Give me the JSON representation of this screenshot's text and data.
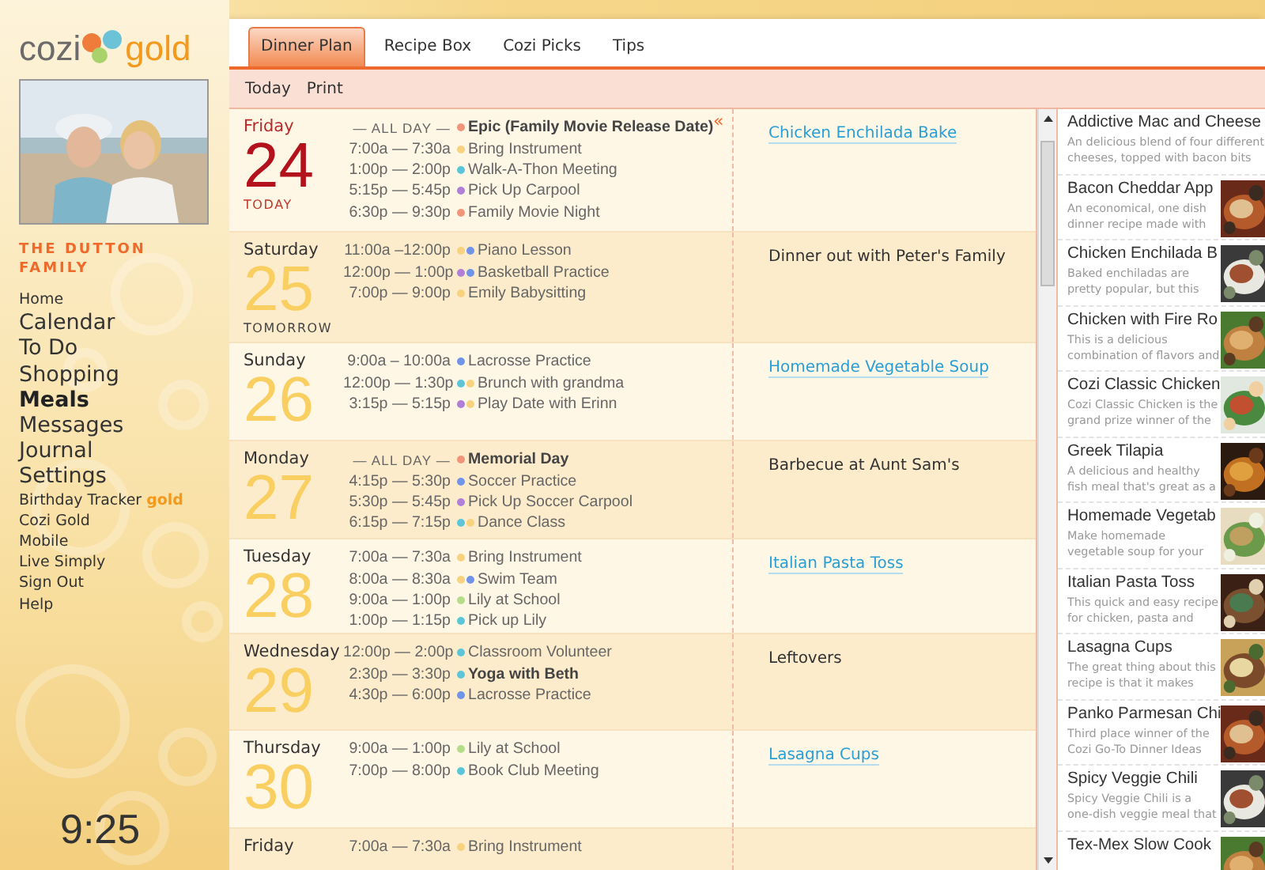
{
  "logo": {
    "name": "cozi",
    "edition": "gold"
  },
  "family": "THE DUTTON FAMILY",
  "nav": [
    {
      "label": "Home",
      "kind": "small",
      "selected": false
    },
    {
      "label": "Calendar",
      "kind": "large",
      "selected": false
    },
    {
      "label": "To Do",
      "kind": "large",
      "selected": false
    },
    {
      "label": "Shopping",
      "kind": "large",
      "selected": false
    },
    {
      "label": "Meals",
      "kind": "large",
      "selected": true
    },
    {
      "label": "Messages",
      "kind": "large",
      "selected": false
    },
    {
      "label": "Journal",
      "kind": "large",
      "selected": false
    },
    {
      "label": "Settings",
      "kind": "large",
      "selected": false
    },
    {
      "label": "Birthday Tracker",
      "kind": "small",
      "selected": false,
      "badge": "gold"
    },
    {
      "label": "Cozi Gold",
      "kind": "small",
      "selected": false
    },
    {
      "label": "Mobile",
      "kind": "small",
      "selected": false
    },
    {
      "label": "Live Simply",
      "kind": "small",
      "selected": false
    },
    {
      "label": "Sign Out",
      "kind": "small",
      "selected": false
    },
    {
      "label": "Help",
      "kind": "small",
      "selected": false
    }
  ],
  "clock": "9:25",
  "tabs": [
    {
      "label": "Dinner Plan",
      "selected": true
    },
    {
      "label": "Recipe Box",
      "selected": false
    },
    {
      "label": "Cozi Picks",
      "selected": false
    },
    {
      "label": "Tips",
      "selected": false
    }
  ],
  "toolbar": [
    "Today",
    "Print"
  ],
  "days": [
    {
      "weekday": "Friday",
      "date": "24",
      "note": "TODAY",
      "today": true,
      "shaded": false,
      "collapse": "«",
      "events": [
        {
          "time": "— ALL DAY —",
          "title": "Epic (Family Movie Release Date)",
          "dots": [
            {
              "color": "#f0957a"
            }
          ],
          "bold": true,
          "allday": true
        },
        {
          "time": "7:00a — 7:30a",
          "title": "Bring Instrument",
          "dots": [
            {
              "color": "#f8d27f"
            }
          ],
          "bold": false,
          "allday": false
        },
        {
          "time": "1:00p — 2:00p",
          "title": "Walk-A-Thon Meeting",
          "dots": [
            {
              "color": "#5cc6d8"
            }
          ],
          "bold": false,
          "allday": false
        },
        {
          "time": "5:15p — 5:45p",
          "title": "Pick Up Carpool",
          "dots": [
            {
              "color": "#b07fd8"
            }
          ],
          "bold": false,
          "allday": false
        },
        {
          "time": "6:30p — 9:30p",
          "title": "Family Movie Night",
          "dots": [
            {
              "color": "#f0957a"
            }
          ],
          "bold": false,
          "allday": false
        }
      ],
      "dinner": {
        "text": "Chicken Enchilada Bake",
        "kind": "link"
      }
    },
    {
      "weekday": "Saturday",
      "date": "25",
      "note": "TOMORROW",
      "today": false,
      "shaded": true,
      "events": [
        {
          "time": "11:00a –12:00p",
          "title": "Piano Lesson",
          "dots": [
            {
              "color": "#f8d27f"
            },
            {
              "color": "#7094e8"
            }
          ],
          "bold": false,
          "allday": false
        },
        {
          "time": "12:00p — 1:00p",
          "title": "Basketball Practice",
          "dots": [
            {
              "color": "#b07fd8"
            },
            {
              "color": "#7094e8"
            }
          ],
          "bold": false,
          "allday": false
        },
        {
          "time": "7:00p — 9:00p",
          "title": "Emily Babysitting",
          "dots": [
            {
              "color": "#f8d27f"
            }
          ],
          "bold": false,
          "allday": false
        }
      ],
      "dinner": {
        "text": "Dinner out with Peter's Family",
        "kind": "text"
      }
    },
    {
      "weekday": "Sunday",
      "date": "26",
      "today": false,
      "shaded": false,
      "events": [
        {
          "time": "9:00a – 10:00a",
          "title": "Lacrosse Practice",
          "dots": [
            {
              "color": "#7094e8"
            }
          ],
          "bold": false,
          "allday": false
        },
        {
          "time": "12:00p — 1:30p",
          "title": "Brunch with grandma",
          "dots": [
            {
              "color": "#5cc6d8"
            },
            {
              "color": "#f8d27f"
            }
          ],
          "bold": false,
          "allday": false
        },
        {
          "time": "3:15p — 5:15p",
          "title": "Play Date with Erinn",
          "dots": [
            {
              "color": "#b07fd8"
            },
            {
              "color": "#f8d27f"
            }
          ],
          "bold": false,
          "allday": false
        }
      ],
      "dinner": {
        "text": "Homemade Vegetable Soup",
        "kind": "link"
      }
    },
    {
      "weekday": "Monday",
      "date": "27",
      "today": false,
      "shaded": true,
      "events": [
        {
          "time": "— ALL DAY —",
          "title": "Memorial Day",
          "dots": [
            {
              "color": "#f0957a"
            }
          ],
          "bold": true,
          "allday": true
        },
        {
          "time": "4:15p — 5:30p",
          "title": "Soccer Practice",
          "dots": [
            {
              "color": "#7094e8"
            }
          ],
          "bold": false,
          "allday": false
        },
        {
          "time": "5:30p — 5:45p",
          "title": "Pick Up Soccer Carpool",
          "dots": [
            {
              "color": "#b07fd8"
            }
          ],
          "bold": false,
          "allday": false
        },
        {
          "time": "6:15p — 7:15p",
          "title": "Dance Class",
          "dots": [
            {
              "color": "#5cc6d8"
            },
            {
              "color": "#f8d27f"
            }
          ],
          "bold": false,
          "allday": false
        }
      ],
      "dinner": {
        "text": "Barbecue at Aunt Sam's",
        "kind": "text"
      }
    },
    {
      "weekday": "Tuesday",
      "date": "28",
      "today": false,
      "shaded": false,
      "events": [
        {
          "time": "7:00a — 7:30a",
          "title": "Bring Instrument",
          "dots": [
            {
              "color": "#f8d27f"
            }
          ],
          "bold": false,
          "allday": false
        },
        {
          "time": "8:00a — 8:30a",
          "title": "Swim Team",
          "dots": [
            {
              "color": "#f8d27f"
            },
            {
              "color": "#7094e8"
            }
          ],
          "bold": false,
          "allday": false
        },
        {
          "time": "9:00a — 1:00p",
          "title": "Lily at School",
          "dots": [
            {
              "color": "#b5dc8a"
            }
          ],
          "bold": false,
          "allday": false
        },
        {
          "time": "1:00p — 1:15p",
          "title": "Pick up Lily",
          "dots": [
            {
              "color": "#5cc6d8"
            }
          ],
          "bold": false,
          "allday": false
        }
      ],
      "dinner": {
        "text": "Italian Pasta Toss",
        "kind": "link"
      }
    },
    {
      "weekday": "Wednesday",
      "date": "29",
      "today": false,
      "shaded": true,
      "events": [
        {
          "time": "12:00p — 2:00p",
          "title": "Classroom Volunteer",
          "dots": [
            {
              "color": "#5cc6d8"
            }
          ],
          "bold": false,
          "allday": false
        },
        {
          "time": "2:30p — 3:30p",
          "title": "Yoga with Beth",
          "dots": [
            {
              "color": "#5cc6d8"
            }
          ],
          "bold": true,
          "allday": false
        },
        {
          "time": "4:30p — 6:00p",
          "title": "Lacrosse Practice",
          "dots": [
            {
              "color": "#7094e8"
            }
          ],
          "bold": false,
          "allday": false
        }
      ],
      "dinner": {
        "text": "Leftovers",
        "kind": "text"
      }
    },
    {
      "weekday": "Thursday",
      "date": "30",
      "today": false,
      "shaded": false,
      "events": [
        {
          "time": "9:00a — 1:00p",
          "title": "Lily at School",
          "dots": [
            {
              "color": "#b5dc8a"
            }
          ],
          "bold": false,
          "allday": false
        },
        {
          "time": "7:00p — 8:00p",
          "title": "Book Club Meeting",
          "dots": [
            {
              "color": "#5cc6d8"
            }
          ],
          "bold": false,
          "allday": false
        }
      ],
      "dinner": {
        "text": "Lasagna Cups",
        "kind": "link"
      }
    },
    {
      "weekday": "Friday",
      "today": false,
      "shaded": true,
      "events": [
        {
          "time": "7:00a — 7:30a",
          "title": "Bring Instrument",
          "dots": [
            {
              "color": "#f8d27f"
            }
          ],
          "bold": false,
          "allday": false
        }
      ]
    }
  ],
  "recipes": [
    {
      "title": "Addictive Mac and Cheese",
      "desc": [
        "An delicious blend of four different",
        "cheeses, topped with bacon bits"
      ]
    },
    {
      "title": "Bacon Cheddar App",
      "desc": [
        "An economical, one dish",
        "dinner recipe made with"
      ],
      "kind": "picture"
    },
    {
      "title": "Chicken Enchilada B",
      "desc": [
        "Baked enchiladas are",
        "pretty popular, but this"
      ],
      "kind": "picture"
    },
    {
      "title": "Chicken with Fire Ro",
      "desc": [
        "This is a delicious",
        "combination of flavors and"
      ],
      "kind": "picture"
    },
    {
      "title": "Cozi Classic Chicken",
      "desc": [
        "Cozi Classic Chicken is the",
        "grand prize winner of the"
      ],
      "kind": "picture"
    },
    {
      "title": "Greek Tilapia",
      "desc": [
        "A delicious and healthy",
        "fish meal that's great as a"
      ],
      "kind": "picture"
    },
    {
      "title": "Homemade Vegetab",
      "desc": [
        "Make homemade",
        "vegetable soup for your"
      ],
      "kind": "picture"
    },
    {
      "title": "Italian Pasta Toss",
      "desc": [
        "This quick and easy recipe",
        "for chicken, pasta and"
      ],
      "kind": "picture"
    },
    {
      "title": "Lasagna Cups",
      "desc": [
        "The great thing about this",
        "recipe is that it makes"
      ],
      "kind": "picture"
    },
    {
      "title": "Panko Parmesan Chi",
      "desc": [
        "Third place winner of the",
        "Cozi Go-To Dinner Ideas"
      ],
      "kind": "picture"
    },
    {
      "title": "Spicy Veggie Chili",
      "desc": [
        "Spicy Veggie Chili is a",
        "one-dish veggie meal that"
      ],
      "kind": "picture"
    },
    {
      "title": "Tex-Mex Slow Cook",
      "kind": "picture"
    }
  ]
}
